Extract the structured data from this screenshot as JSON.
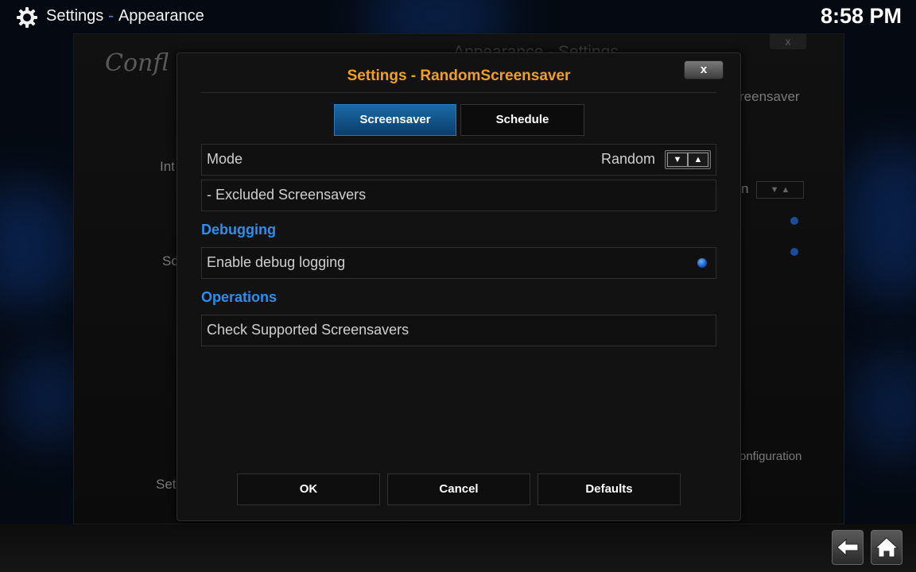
{
  "header": {
    "section": "Settings",
    "separator": "-",
    "page": "Appearance",
    "time": "8:58 PM"
  },
  "background": {
    "logo_text": "Confl",
    "dialog_title": "Appearance - Settings",
    "close_label": "x",
    "items": [
      "Int",
      "Sc",
      "Sett",
      "reensaver",
      "n",
      "onfiguration"
    ]
  },
  "dialog": {
    "title": "Settings - RandomScreensaver",
    "close_label": "x",
    "tabs": [
      {
        "label": "Screensaver",
        "active": true
      },
      {
        "label": "Schedule",
        "active": false
      }
    ],
    "rows": {
      "mode": {
        "label": "Mode",
        "value": "Random"
      },
      "excluded": {
        "label": "- Excluded Screensavers"
      },
      "debug_logging": {
        "label": "Enable debug logging",
        "enabled": true
      },
      "check_supported": {
        "label": "Check Supported Screensavers"
      }
    },
    "sections": {
      "debugging": "Debugging",
      "operations": "Operations"
    },
    "buttons": {
      "ok": "OK",
      "cancel": "Cancel",
      "defaults": "Defaults"
    }
  },
  "colors": {
    "title": "#f0a020",
    "section": "#2b8ff0",
    "tab_active": "#1a6aa8"
  },
  "icons": {
    "gear": "gear-icon",
    "back": "back-arrow-icon",
    "home": "home-icon"
  }
}
